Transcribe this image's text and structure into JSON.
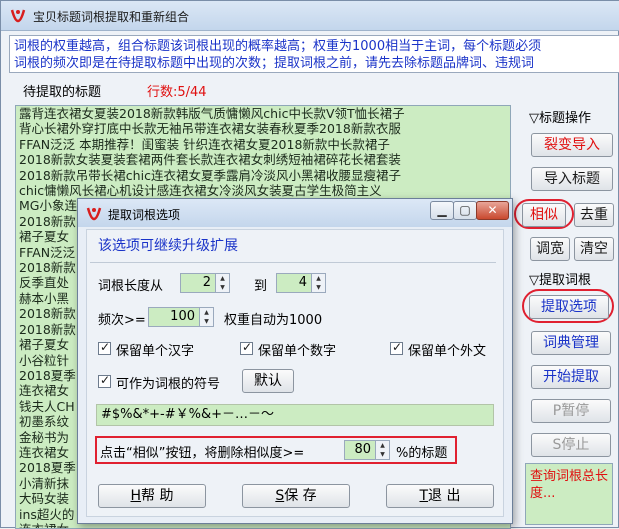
{
  "window": {
    "title": "宝贝标题词根提取和重新组合"
  },
  "hint_lines": [
    "词根的权重越高，组合标题该词根出现的概率越高；权重为1000相当于主词，每个标题必须",
    "词根的频次即是在待提取标题中出现的次数；提取词根之前，请先去除标题品牌词、违规词"
  ],
  "pending": {
    "label": "待提取的标题",
    "count_label": "行数:5/44"
  },
  "titles": [
    "露背连衣裙女夏装2018新款韩版气质慵懒风chic中长款V领T恤长裙子",
    "背心长裙外穿打底中长款无袖吊带连衣裙女装春秋夏季2018新款衣服",
    "FFAN泛泛  本期推荐！闺蜜装  针织连衣裙女夏2018新款中长款裙子",
    "2018新款女装夏装套裙两件套长款连衣裙女刺绣短袖裙碎花长裙套装",
    "2018新款吊带长裙chic连衣裙女夏季露肩冷淡风小黑裙收腰显瘦裙子",
    "chic慵懒风长裙心机设计感连衣裙女冷淡风女装夏古学生极简主义",
    "MG小象连",
    "2018新款",
    "裙子夏女",
    "FFAN泛泛",
    "2018新款",
    "反季直处",
    "赫本小黑",
    "2018新款",
    "2018新款",
    "裙子夏女",
    "小谷粒针",
    "2018夏季",
    "连衣裙女",
    "钱夫人CH",
    "初墨系纹",
    "金秘书为",
    "连衣裙女",
    "2018夏季",
    "小清新抹",
    "大码女装",
    "ins超火的",
    "连衣裙女"
  ],
  "right_panel": {
    "group_title_ops": "▽标题操作",
    "btn_split_import": "裂变导入",
    "btn_import_titles": "导入标题",
    "btn_similar": "相似",
    "btn_dedupe": "去重",
    "btn_widen": "调宽",
    "btn_clear": "清空",
    "group_extract": "▽提取词根",
    "btn_extract_options": "提取选项",
    "btn_dict_manage": "词典管理",
    "btn_start_extract": "开始提取",
    "btn_pause": "P暂停",
    "btn_stop": "S停止",
    "stat_text": "查询词根总长度..."
  },
  "dialog": {
    "title": "提取词根选项",
    "heading": "该选项可继续升级扩展",
    "length_from_label": "词根长度从",
    "length_from_value": "2",
    "length_to_label": "到",
    "length_to_value": "4",
    "freq_label": "频次>=",
    "freq_value": "100",
    "freq_note": "权重自动为1000",
    "keep_single_han": "保留单个汉字",
    "keep_single_digit": "保留单个数字",
    "keep_single_foreign": "保留单个外文",
    "as_symbol_label": "可作为词根的符号",
    "btn_default": "默认",
    "symbols": "#$%&*+-#￥%&+－…－～",
    "similar_pre": "点击“相似”按钮，将删除相似度>=",
    "similar_value": "80",
    "similar_post": "%的标题",
    "btn_help_key": "H",
    "btn_help_rest": "帮  助",
    "btn_save_key": "S",
    "btn_save_rest": "保  存",
    "btn_exit_key": "T",
    "btn_exit_rest": "退  出"
  },
  "colors": {
    "accent_red": "#e02030",
    "hint_blue": "#1a33c8",
    "list_green": "#ccecc2"
  }
}
